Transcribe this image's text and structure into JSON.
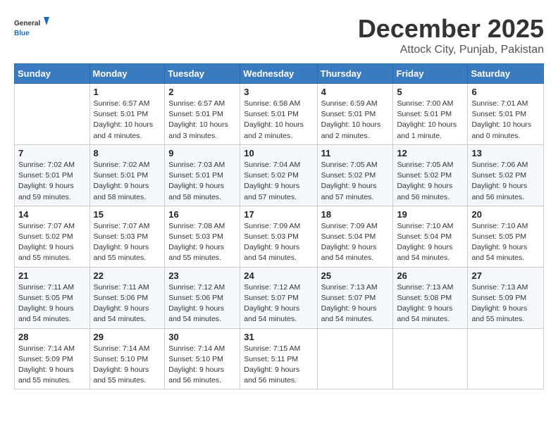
{
  "logo": {
    "general": "General",
    "blue": "Blue"
  },
  "title": "December 2025",
  "subtitle": "Attock City, Punjab, Pakistan",
  "days_of_week": [
    "Sunday",
    "Monday",
    "Tuesday",
    "Wednesday",
    "Thursday",
    "Friday",
    "Saturday"
  ],
  "weeks": [
    [
      {
        "day": "",
        "info": ""
      },
      {
        "day": "1",
        "info": "Sunrise: 6:57 AM\nSunset: 5:01 PM\nDaylight: 10 hours\nand 4 minutes."
      },
      {
        "day": "2",
        "info": "Sunrise: 6:57 AM\nSunset: 5:01 PM\nDaylight: 10 hours\nand 3 minutes."
      },
      {
        "day": "3",
        "info": "Sunrise: 6:58 AM\nSunset: 5:01 PM\nDaylight: 10 hours\nand 2 minutes."
      },
      {
        "day": "4",
        "info": "Sunrise: 6:59 AM\nSunset: 5:01 PM\nDaylight: 10 hours\nand 2 minutes."
      },
      {
        "day": "5",
        "info": "Sunrise: 7:00 AM\nSunset: 5:01 PM\nDaylight: 10 hours\nand 1 minute."
      },
      {
        "day": "6",
        "info": "Sunrise: 7:01 AM\nSunset: 5:01 PM\nDaylight: 10 hours\nand 0 minutes."
      }
    ],
    [
      {
        "day": "7",
        "info": "Sunrise: 7:02 AM\nSunset: 5:01 PM\nDaylight: 9 hours\nand 59 minutes."
      },
      {
        "day": "8",
        "info": "Sunrise: 7:02 AM\nSunset: 5:01 PM\nDaylight: 9 hours\nand 58 minutes."
      },
      {
        "day": "9",
        "info": "Sunrise: 7:03 AM\nSunset: 5:01 PM\nDaylight: 9 hours\nand 58 minutes."
      },
      {
        "day": "10",
        "info": "Sunrise: 7:04 AM\nSunset: 5:02 PM\nDaylight: 9 hours\nand 57 minutes."
      },
      {
        "day": "11",
        "info": "Sunrise: 7:05 AM\nSunset: 5:02 PM\nDaylight: 9 hours\nand 57 minutes."
      },
      {
        "day": "12",
        "info": "Sunrise: 7:05 AM\nSunset: 5:02 PM\nDaylight: 9 hours\nand 56 minutes."
      },
      {
        "day": "13",
        "info": "Sunrise: 7:06 AM\nSunset: 5:02 PM\nDaylight: 9 hours\nand 56 minutes."
      }
    ],
    [
      {
        "day": "14",
        "info": "Sunrise: 7:07 AM\nSunset: 5:02 PM\nDaylight: 9 hours\nand 55 minutes."
      },
      {
        "day": "15",
        "info": "Sunrise: 7:07 AM\nSunset: 5:03 PM\nDaylight: 9 hours\nand 55 minutes."
      },
      {
        "day": "16",
        "info": "Sunrise: 7:08 AM\nSunset: 5:03 PM\nDaylight: 9 hours\nand 55 minutes."
      },
      {
        "day": "17",
        "info": "Sunrise: 7:09 AM\nSunset: 5:03 PM\nDaylight: 9 hours\nand 54 minutes."
      },
      {
        "day": "18",
        "info": "Sunrise: 7:09 AM\nSunset: 5:04 PM\nDaylight: 9 hours\nand 54 minutes."
      },
      {
        "day": "19",
        "info": "Sunrise: 7:10 AM\nSunset: 5:04 PM\nDaylight: 9 hours\nand 54 minutes."
      },
      {
        "day": "20",
        "info": "Sunrise: 7:10 AM\nSunset: 5:05 PM\nDaylight: 9 hours\nand 54 minutes."
      }
    ],
    [
      {
        "day": "21",
        "info": "Sunrise: 7:11 AM\nSunset: 5:05 PM\nDaylight: 9 hours\nand 54 minutes."
      },
      {
        "day": "22",
        "info": "Sunrise: 7:11 AM\nSunset: 5:06 PM\nDaylight: 9 hours\nand 54 minutes."
      },
      {
        "day": "23",
        "info": "Sunrise: 7:12 AM\nSunset: 5:06 PM\nDaylight: 9 hours\nand 54 minutes."
      },
      {
        "day": "24",
        "info": "Sunrise: 7:12 AM\nSunset: 5:07 PM\nDaylight: 9 hours\nand 54 minutes."
      },
      {
        "day": "25",
        "info": "Sunrise: 7:13 AM\nSunset: 5:07 PM\nDaylight: 9 hours\nand 54 minutes."
      },
      {
        "day": "26",
        "info": "Sunrise: 7:13 AM\nSunset: 5:08 PM\nDaylight: 9 hours\nand 54 minutes."
      },
      {
        "day": "27",
        "info": "Sunrise: 7:13 AM\nSunset: 5:09 PM\nDaylight: 9 hours\nand 55 minutes."
      }
    ],
    [
      {
        "day": "28",
        "info": "Sunrise: 7:14 AM\nSunset: 5:09 PM\nDaylight: 9 hours\nand 55 minutes."
      },
      {
        "day": "29",
        "info": "Sunrise: 7:14 AM\nSunset: 5:10 PM\nDaylight: 9 hours\nand 55 minutes."
      },
      {
        "day": "30",
        "info": "Sunrise: 7:14 AM\nSunset: 5:10 PM\nDaylight: 9 hours\nand 56 minutes."
      },
      {
        "day": "31",
        "info": "Sunrise: 7:15 AM\nSunset: 5:11 PM\nDaylight: 9 hours\nand 56 minutes."
      },
      {
        "day": "",
        "info": ""
      },
      {
        "day": "",
        "info": ""
      },
      {
        "day": "",
        "info": ""
      }
    ]
  ]
}
